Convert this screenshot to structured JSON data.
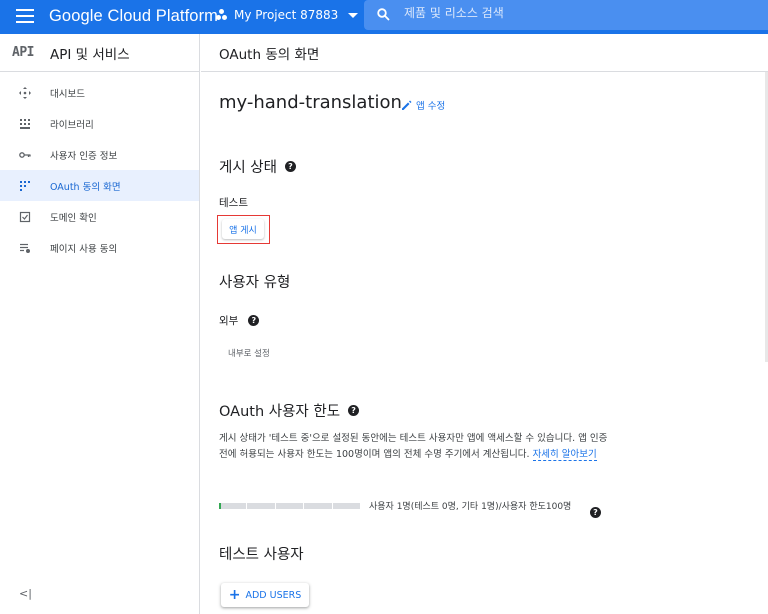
{
  "topbar": {
    "brand": "Google Cloud Platform",
    "project": "My Project 87883",
    "search_placeholder": "제품 및 리소스 검색"
  },
  "sidebar": {
    "logo": "API",
    "title": "API 및 서비스",
    "items": [
      {
        "label": "대시보드",
        "icon": "dashboard-icon",
        "active": false
      },
      {
        "label": "라이브러리",
        "icon": "library-icon",
        "active": false
      },
      {
        "label": "사용자 인증 정보",
        "icon": "key-icon",
        "active": false
      },
      {
        "label": "OAuth 동의 화면",
        "icon": "consent-icon",
        "active": true
      },
      {
        "label": "도메인 확인",
        "icon": "domain-check-icon",
        "active": false
      },
      {
        "label": "페이지 사용 동의",
        "icon": "page-consent-icon",
        "active": false
      }
    ]
  },
  "main": {
    "header": "OAuth 동의 화면",
    "app_name": "my-hand-translation",
    "edit_app": "앱 수정",
    "publish_section": {
      "title": "게시 상태",
      "status": "테스트",
      "publish_button": "앱 게시"
    },
    "user_type_section": {
      "title": "사용자 유형",
      "value": "외부",
      "make_internal": "내부로 설정"
    },
    "oauth_limit_section": {
      "title": "OAuth 사용자 한도",
      "description": "게시 상태가 '테스트 중'으로 설정된 동안에는 테스트 사용자만 앱에 액세스할 수 있습니다. 앱 인증 전에 허용되는 사용자 한도는 100명이며 앱의 전체 수명 주기에서 계산됩니다.",
      "learn_more": "자세히 알아보기",
      "quota_text": "사용자 1명(테스트 0명, 기타 1명)/사용자 한도100명",
      "quota_fraction": 0.01
    },
    "test_users_section": {
      "title": "테스트 사용자",
      "add_users": "ADD USERS"
    }
  },
  "colors": {
    "primary": "#1a73e8",
    "active_bg": "#e8f0fe",
    "highlight_box": "#e53935"
  }
}
